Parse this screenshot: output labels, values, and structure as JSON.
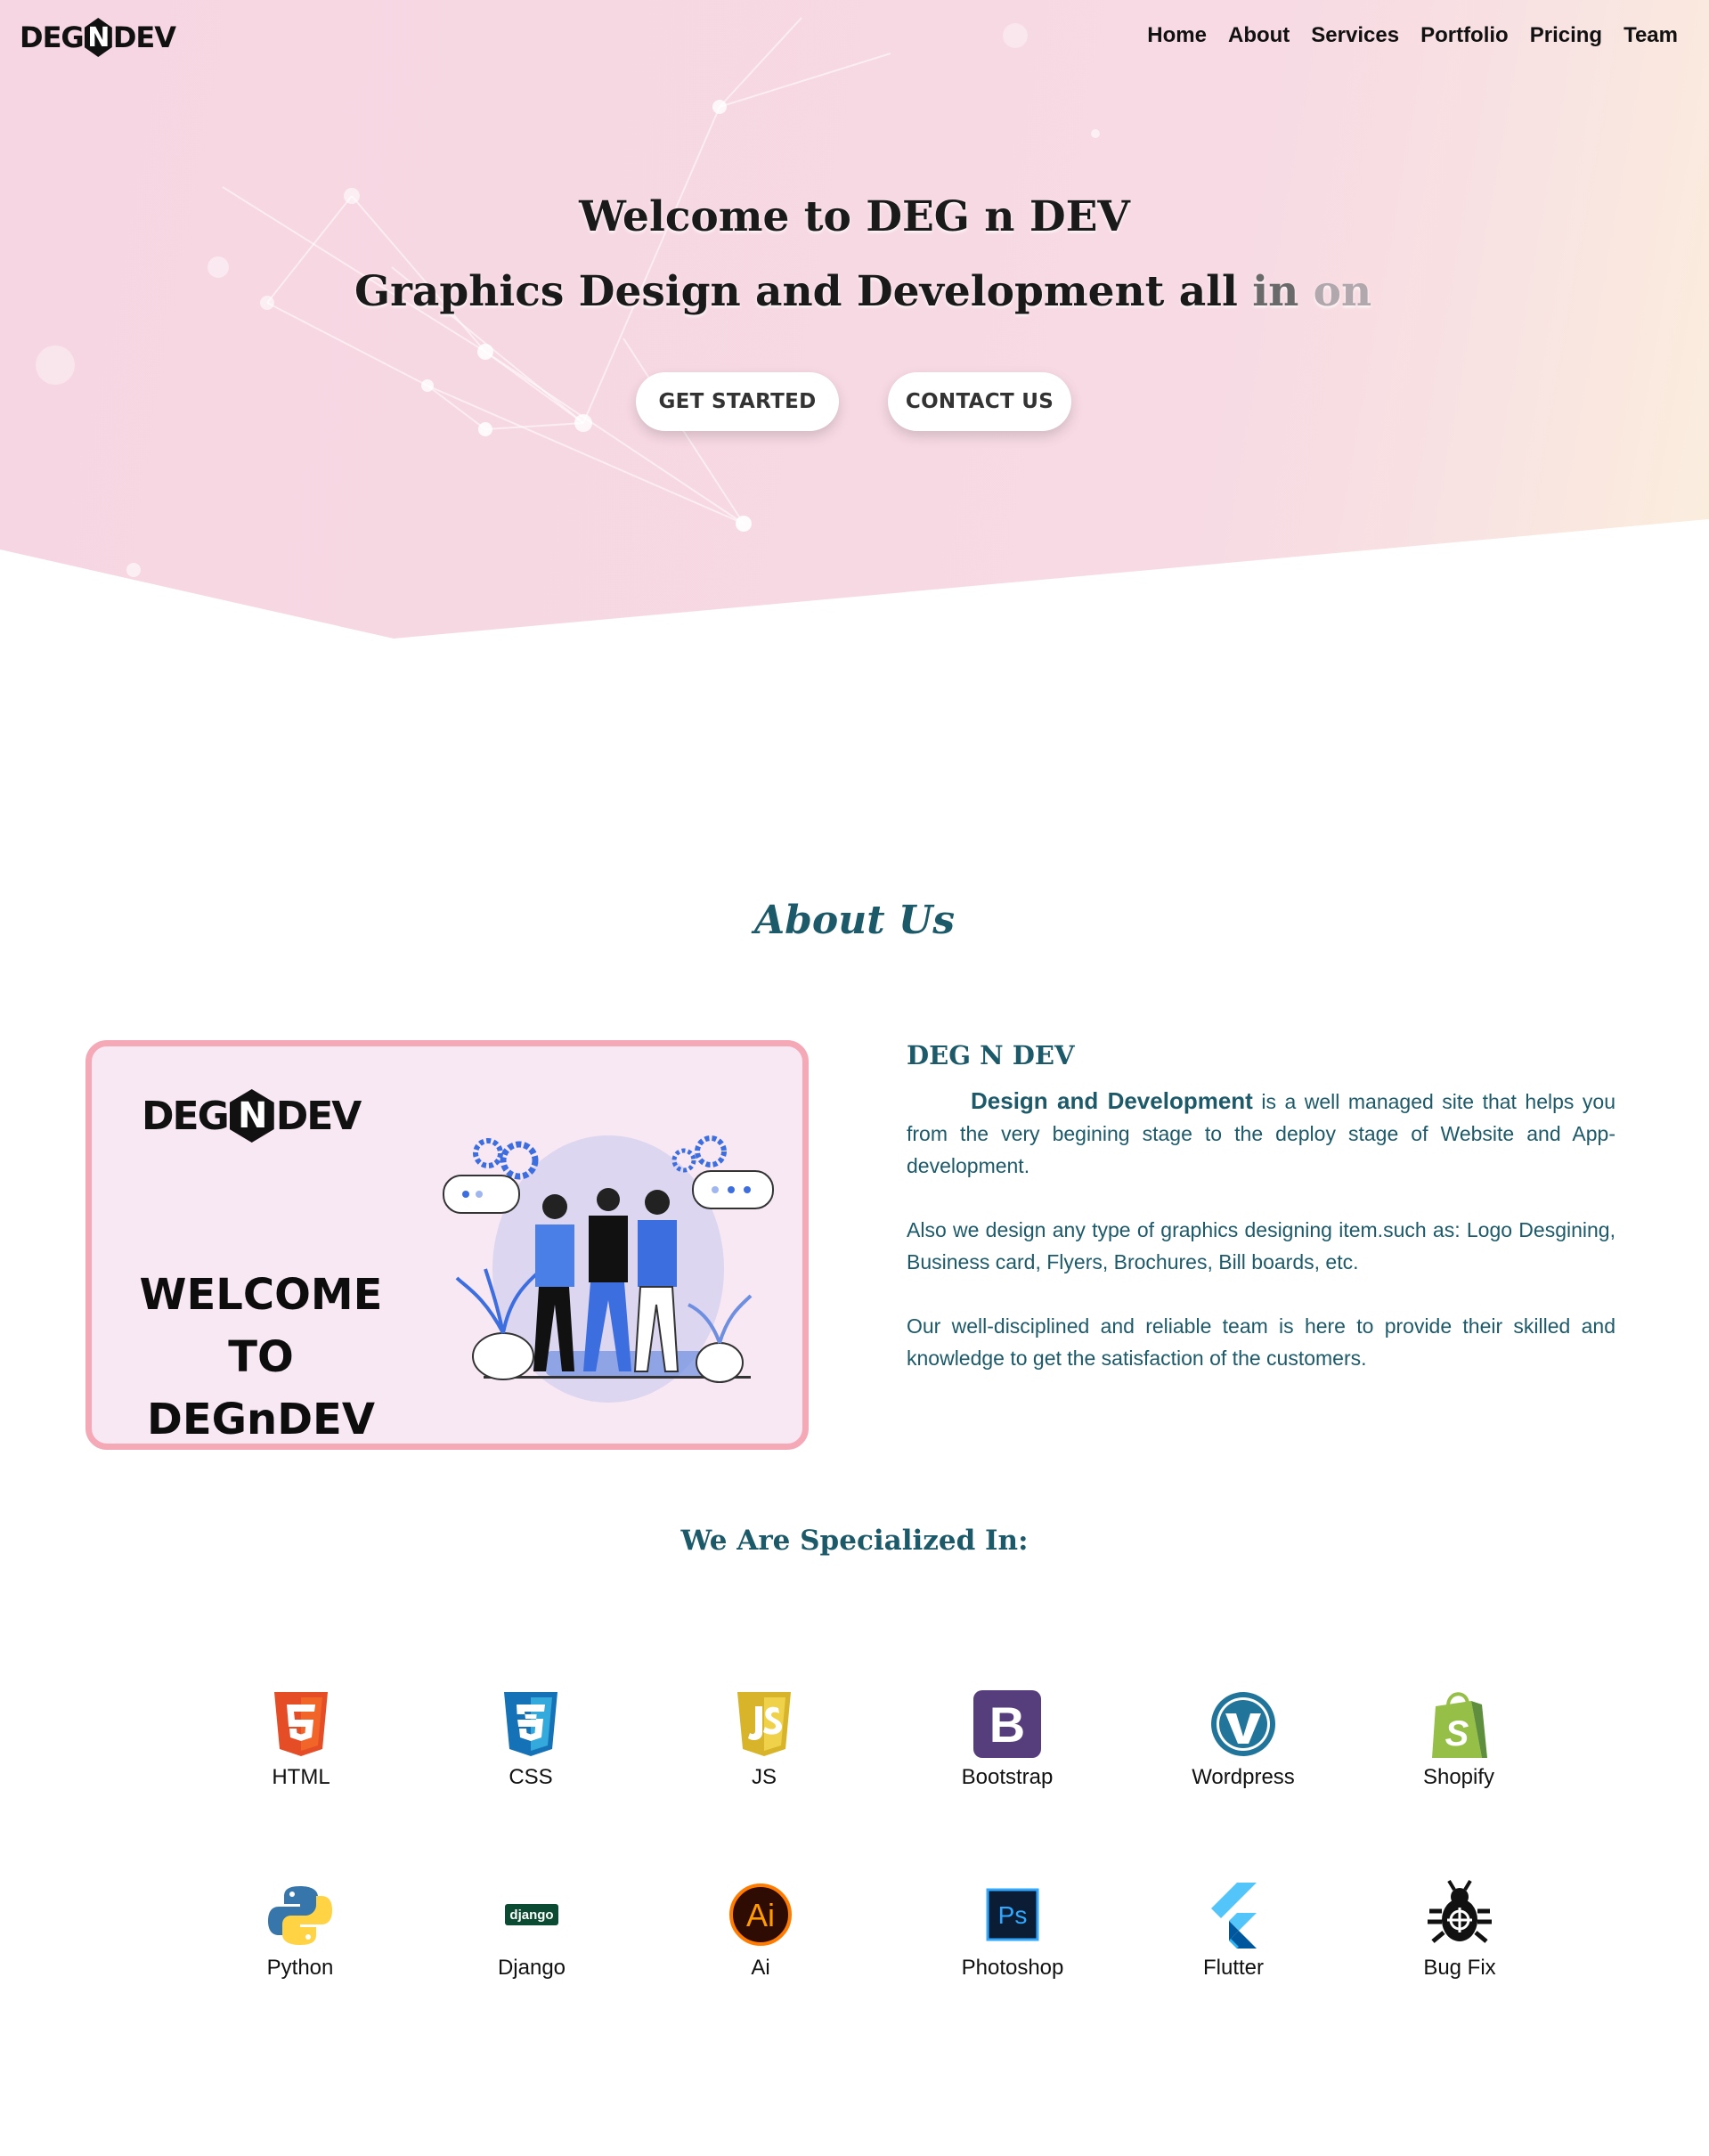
{
  "header": {
    "logo": {
      "left": "DEG",
      "mark": "N",
      "right": "DEV"
    },
    "nav": [
      "Home",
      "About",
      "Services",
      "Portfolio",
      "Pricing",
      "Team"
    ]
  },
  "hero": {
    "title": "Welcome to DEG n DEV",
    "subtitle_main": "Graphics Design and Development all ",
    "subtitle_fade1": "in ",
    "subtitle_fade2": "on",
    "btn_start": "GET STARTED",
    "btn_contact": "CONTACT US"
  },
  "about": {
    "title": "About Us",
    "card": {
      "logo_left": "DEG",
      "logo_mark": "N",
      "logo_right": "DEV",
      "welcome_line1": "WELCOME TO",
      "welcome_line2": "DEGnDEV"
    },
    "heading": "DEG N DEV",
    "lead": "Design and Development",
    "para1_rest": " is a well managed site that helps you from the very begining stage to the deploy stage of Website and App-development.",
    "para2": "Also we design any type of graphics designing item.such as: Logo Desgining, Business card, Flyers, Brochures, Bill boards, etc.",
    "para3": "Our well-disciplined and reliable team is here to provide their skilled and knowledge to get the satisfaction of the customers."
  },
  "skills": {
    "title": "We Are Specialized In:",
    "items": [
      {
        "label": "HTML",
        "icon": "html5-icon"
      },
      {
        "label": "CSS",
        "icon": "css3-icon"
      },
      {
        "label": "JS",
        "icon": "javascript-icon"
      },
      {
        "label": "Bootstrap",
        "icon": "bootstrap-icon"
      },
      {
        "label": "Wordpress",
        "icon": "wordpress-icon"
      },
      {
        "label": "Shopify",
        "icon": "shopify-icon"
      },
      {
        "label": "Python",
        "icon": "python-icon"
      },
      {
        "label": "Django",
        "icon": "django-icon",
        "text": "django"
      },
      {
        "label": "Ai",
        "icon": "illustrator-icon",
        "text": "Ai"
      },
      {
        "label": "Photoshop",
        "icon": "photoshop-icon",
        "text": "Ps"
      },
      {
        "label": "Flutter",
        "icon": "flutter-icon"
      },
      {
        "label": "Bug Fix",
        "icon": "bug-icon"
      }
    ]
  },
  "colors": {
    "accent": "#1c5a6a",
    "hero_bg": "#f6d6e2",
    "card_border": "#f5a8b6",
    "card_bg": "#f8e8f3"
  }
}
